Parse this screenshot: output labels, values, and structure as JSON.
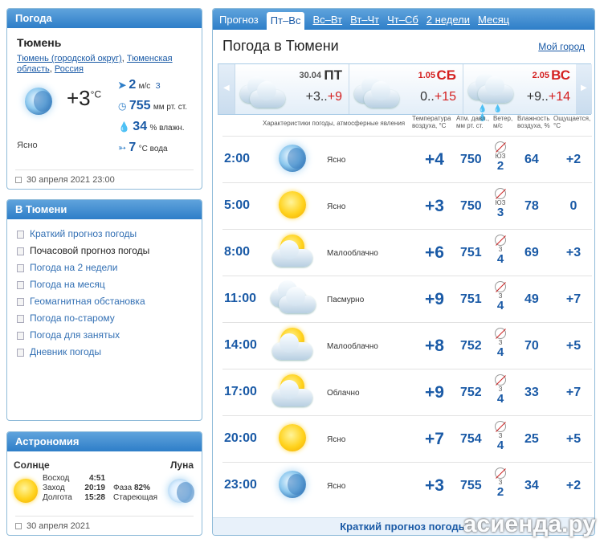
{
  "left_weather": {
    "title": "Погода",
    "city": "Тюмень",
    "loc_links": [
      "Тюмень (городской округ)",
      "Тюменская область",
      "Россия"
    ],
    "temp": "+3",
    "temp_unit": "°C",
    "wind": "2",
    "wind_unit": "м/с",
    "wind_dir": "З",
    "pressure": "755",
    "pressure_unit": "мм рт. ст.",
    "humidity": "34",
    "humidity_unit": "% влажн.",
    "water": "7",
    "water_unit": "°C вода",
    "condition": "Ясно",
    "date": "30 апреля 2021 23:00"
  },
  "left_menu": {
    "title": "В Тюмени",
    "items": [
      "Краткий прогноз погоды",
      "Почасовой прогноз погоды",
      "Погода на 2 недели",
      "Погода на месяц",
      "Геомагнитная обстановка",
      "Погода по-старому",
      "Погода для занятых",
      "Дневник погоды"
    ]
  },
  "astro": {
    "title": "Астрономия",
    "sun_label": "Солнце",
    "moon_label": "Луна",
    "rise_label": "Восход",
    "rise": "4:51",
    "set_label": "Заход",
    "set": "20:19",
    "len_label": "Долгота",
    "len": "15:28",
    "phase_label": "Фаза",
    "phase": "82%",
    "phase_state": "Стареющая",
    "date": "30 апреля 2021"
  },
  "tabs": {
    "lead": "Прогноз",
    "items": [
      "Пт–Вс",
      "Вс–Вт",
      "Вт–Чт",
      "Чт–Сб",
      "2 недели",
      "Месяц"
    ]
  },
  "main": {
    "title": "Погода в Тюмени",
    "my_city": "Мой город"
  },
  "days": [
    {
      "date": "30.04",
      "dow": "ПТ",
      "lo": "+3..",
      "hi": "+9"
    },
    {
      "date": "1.05",
      "dow": "СБ",
      "lo": "0..",
      "hi": "+15"
    },
    {
      "date": "2.05",
      "dow": "ВС",
      "lo": "+9..",
      "hi": "+14"
    }
  ],
  "col_headers": {
    "desc": "Характеристики погоды, атмосферные явления",
    "temp": "Температура воздуха, °С",
    "press": "Атм. давл., мм рт. ст.",
    "wind": "Ветер, м/с",
    "hum": "Влажность воздуха, %",
    "feel": "Ощущается, °С"
  },
  "rows": [
    {
      "time": "2:00",
      "icon": "moon-icon",
      "desc": "Ясно",
      "temp": "+4",
      "press": "750",
      "wdir": "ЮЗ",
      "wspd": "2",
      "hum": "64",
      "feel": "+2"
    },
    {
      "time": "5:00",
      "icon": "sun-icon",
      "desc": "Ясно",
      "temp": "+3",
      "press": "750",
      "wdir": "ЮЗ",
      "wspd": "3",
      "hum": "78",
      "feel": "0"
    },
    {
      "time": "8:00",
      "icon": "sun-cloud-icon",
      "desc": "Малооблачно",
      "temp": "+6",
      "press": "751",
      "wdir": "З",
      "wspd": "4",
      "hum": "69",
      "feel": "+3"
    },
    {
      "time": "11:00",
      "icon": "clouds-icon",
      "desc": "Пасмурно",
      "temp": "+9",
      "press": "751",
      "wdir": "З",
      "wspd": "4",
      "hum": "49",
      "feel": "+7"
    },
    {
      "time": "14:00",
      "icon": "sun-cloud-icon",
      "desc": "Малооблачно",
      "temp": "+8",
      "press": "752",
      "wdir": "З",
      "wspd": "4",
      "hum": "70",
      "feel": "+5"
    },
    {
      "time": "17:00",
      "icon": "sun-cloud-icon",
      "desc": "Облачно",
      "temp": "+9",
      "press": "752",
      "wdir": "З",
      "wspd": "4",
      "hum": "33",
      "feel": "+7"
    },
    {
      "time": "20:00",
      "icon": "sun-icon",
      "desc": "Ясно",
      "temp": "+7",
      "press": "754",
      "wdir": "З",
      "wspd": "4",
      "hum": "25",
      "feel": "+5"
    },
    {
      "time": "23:00",
      "icon": "moon-icon",
      "desc": "Ясно",
      "temp": "+3",
      "press": "755",
      "wdir": "З",
      "wspd": "2",
      "hum": "34",
      "feel": "+2"
    }
  ],
  "footer": "Краткий прогноз погоды",
  "watermark": "асиенда.ру"
}
